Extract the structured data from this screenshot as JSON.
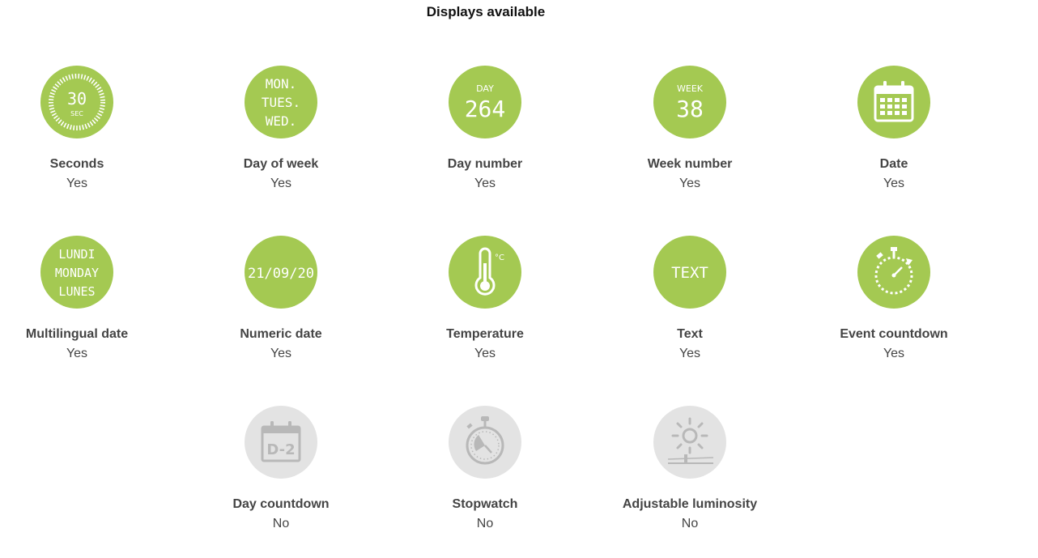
{
  "title": "Displays available",
  "colors": {
    "active": "#a4c952",
    "inactive": "#e3e3e3",
    "icon_active": "#ffffff",
    "icon_inactive": "#b8b8b8"
  },
  "features": [
    {
      "icon": "seconds-icon",
      "icon_text": [
        "30",
        "SEC"
      ],
      "label": "Seconds",
      "value": "Yes"
    },
    {
      "icon": "day-of-week-icon",
      "icon_text": [
        "MON.",
        "TUES.",
        "WED."
      ],
      "label": "Day of week",
      "value": "Yes"
    },
    {
      "icon": "day-number-icon",
      "icon_text": [
        "DAY",
        "264"
      ],
      "label": "Day number",
      "value": "Yes"
    },
    {
      "icon": "week-number-icon",
      "icon_text": [
        "WEEK",
        "38"
      ],
      "label": "Week number",
      "value": "Yes"
    },
    {
      "icon": "calendar-icon",
      "label": "Date",
      "value": "Yes"
    },
    {
      "icon": "multilingual-date-icon",
      "icon_text": [
        "LUNDI",
        "MONDAY",
        "LUNES"
      ],
      "label": "Multilingual date",
      "value": "Yes"
    },
    {
      "icon": "numeric-date-icon",
      "icon_text": [
        "21/09/20"
      ],
      "label": "Numeric date",
      "value": "Yes"
    },
    {
      "icon": "thermometer-icon",
      "icon_text": [
        "°C"
      ],
      "label": "Temperature",
      "value": "Yes"
    },
    {
      "icon": "text-icon",
      "icon_text": [
        "TEXT"
      ],
      "label": "Text",
      "value": "Yes"
    },
    {
      "icon": "event-countdown-icon",
      "label": "Event countdown",
      "value": "Yes"
    },
    {
      "icon": "day-countdown-icon",
      "icon_text": [
        "D-2"
      ],
      "label": "Day countdown",
      "value": "No"
    },
    {
      "icon": "stopwatch-icon",
      "label": "Stopwatch",
      "value": "No"
    },
    {
      "icon": "luminosity-icon",
      "label": "Adjustable luminosity",
      "value": "No"
    }
  ]
}
